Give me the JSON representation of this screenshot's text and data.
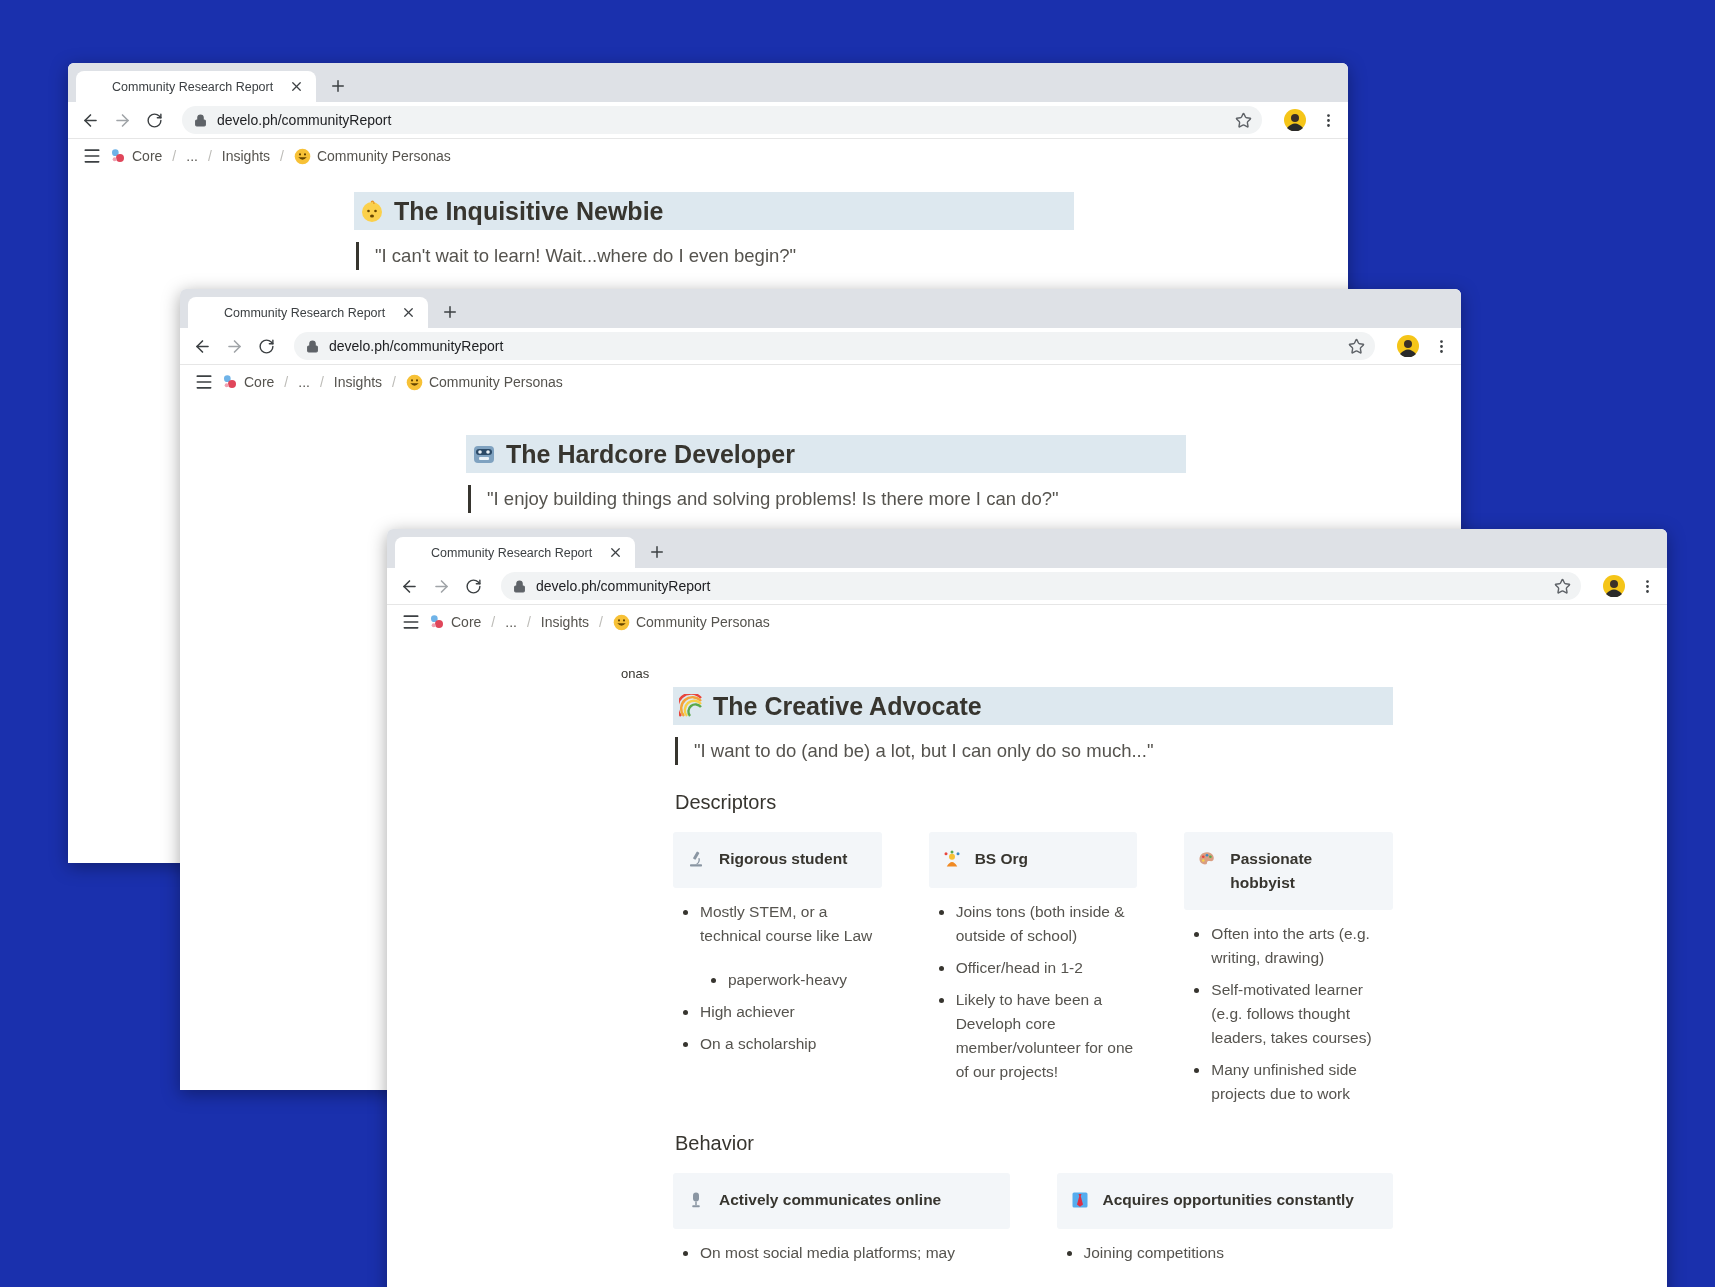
{
  "windows": [
    {
      "tab_title": "Community Research Report",
      "url": "develo.ph/communityReport",
      "breadcrumb": {
        "separator": "/",
        "items": [
          {
            "label": "Core",
            "kind": "logo"
          },
          {
            "label": "..."
          },
          {
            "label": "Insights"
          },
          {
            "label": "Community Personas",
            "kind": "grin"
          }
        ]
      },
      "persona": {
        "kind": "baby",
        "title": "The Inquisitive Newbie",
        "quote": "\"I can't wait to learn! Wait...where do I even begin?\""
      }
    },
    {
      "tab_title": "Community Research Report",
      "url": "develo.ph/communityReport",
      "breadcrumb": {
        "separator": "/",
        "items": [
          {
            "label": "Core",
            "kind": "logo"
          },
          {
            "label": "..."
          },
          {
            "label": "Insights"
          },
          {
            "label": "Community Personas",
            "kind": "grin"
          }
        ]
      },
      "persona": {
        "kind": "robot",
        "title": "The Hardcore Developer",
        "quote": "\"I enjoy building things and solving problems! Is there more I can do?\""
      }
    },
    {
      "tab_title": "Community Research Report",
      "url": "develo.ph/communityReport",
      "breadcrumb": {
        "separator": "/",
        "items": [
          {
            "label": "Core",
            "kind": "logo"
          },
          {
            "label": "..."
          },
          {
            "label": "Insights"
          },
          {
            "label": "Community Personas",
            "kind": "grin"
          }
        ]
      },
      "fragment": "onas",
      "persona": {
        "kind": "rainbow",
        "title": "The Creative Advocate",
        "quote": "\"I want to do (and be) a lot, but I can only do so much...\""
      },
      "sections": [
        {
          "title": "Descriptors",
          "cards": [
            {
              "kind": "microscope",
              "title": "Rigorous student",
              "bullets": [
                {
                  "text": "Mostly STEM, or a technical course like Law",
                  "children": [
                    {
                      "text": "paperwork-heavy"
                    }
                  ]
                },
                {
                  "text": "High achiever"
                },
                {
                  "text": "On a scholarship"
                }
              ]
            },
            {
              "kind": "juggler",
              "title": "BS Org",
              "bullets": [
                {
                  "text": "Joins tons (both inside & outside of school)"
                },
                {
                  "text": "Officer/head in 1-2"
                },
                {
                  "text": "Likely to have been a Developh core member/volunteer for one of our projects!"
                }
              ]
            },
            {
              "kind": "palette",
              "title": "Passionate hobbyist",
              "bullets": [
                {
                  "text": "Often into the arts (e.g. writing, drawing)"
                },
                {
                  "text": "Self-motivated learner (e.g. follows thought leaders, takes courses)"
                },
                {
                  "text": "Many unfinished side projects due to work"
                }
              ]
            }
          ]
        },
        {
          "title": "Behavior",
          "cards": [
            {
              "kind": "microphone",
              "title": "Actively communicates online",
              "bullets": [
                {
                  "text": "On most social media platforms; may"
                }
              ]
            },
            {
              "kind": "necktie",
              "title": "Acquires opportunities constantly",
              "bullets": [
                {
                  "text": "Joining competitions"
                }
              ]
            }
          ]
        }
      ]
    }
  ]
}
